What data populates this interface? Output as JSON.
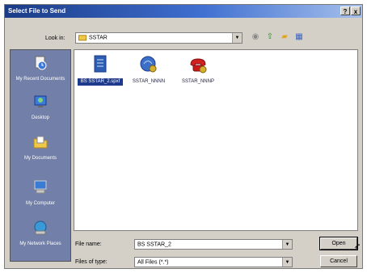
{
  "window": {
    "title": "Select File to Send"
  },
  "titlebar_buttons": {
    "help": "?",
    "close": "x"
  },
  "lookin": {
    "label": "Look in:",
    "value": "SSTAR"
  },
  "places": [
    {
      "label": "My Recent Documents"
    },
    {
      "label": "Desktop"
    },
    {
      "label": "My Documents"
    },
    {
      "label": "My Computer"
    },
    {
      "label": "My Network Places"
    }
  ],
  "files": [
    {
      "name": "BS SSTAR_2.spxf",
      "selected": true
    },
    {
      "name": "SSTAR_NNNN"
    },
    {
      "name": "SSTAR_NNNP"
    }
  ],
  "filename": {
    "label": "File name:",
    "value": "BS SSTAR_2"
  },
  "filetype": {
    "label": "Files of type:",
    "value": "All Files (*.*)"
  },
  "buttons": {
    "open": "Open",
    "cancel": "Cancel"
  },
  "colors": {
    "title_start": "#1a3b86",
    "title_end": "#a6c0ec",
    "selection": "#1d3a8c",
    "places_bg": "#727fa8"
  }
}
